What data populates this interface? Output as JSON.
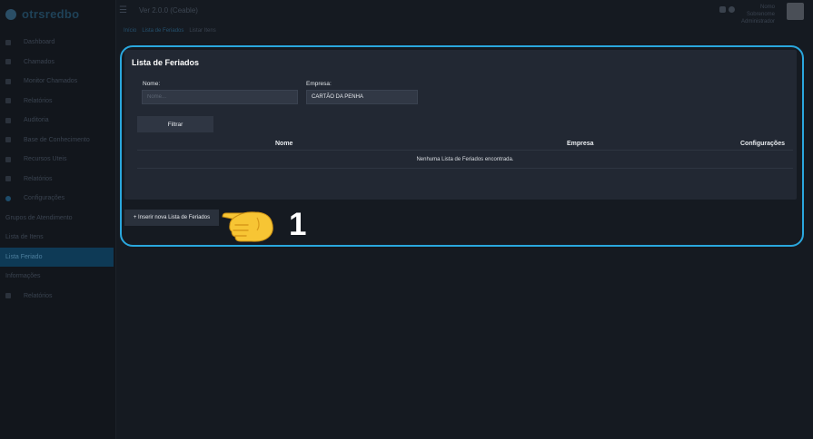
{
  "app": {
    "logo_text": "otrsredbo",
    "title": "Ver 2.0.0 (Ceable)"
  },
  "topbar": {
    "user_line1": "Nomo Sobrenome",
    "user_line2": "Administrador"
  },
  "breadcrumb": [
    "Início",
    "Lista de Feriados",
    "Listar Itens"
  ],
  "sidebar": {
    "items": [
      {
        "label": "Dashboard"
      },
      {
        "label": "Chamados"
      },
      {
        "label": "Monitor Chamados"
      },
      {
        "label": "Relatórios"
      },
      {
        "label": "Auditoria"
      },
      {
        "label": "Base de Conhecimento"
      },
      {
        "label": "Recursos Uteis"
      },
      {
        "label": "Relatórios"
      },
      {
        "label": "Configurações"
      },
      {
        "label": "Grupos de Atendimento"
      },
      {
        "label": "Lista de Itens"
      },
      {
        "label": "Lista Feriado"
      },
      {
        "label": "Informações"
      },
      {
        "label": "Relatórios"
      }
    ]
  },
  "panel": {
    "title": "Lista de Feriados",
    "nome_label": "Nome:",
    "nome_placeholder": "Nome...",
    "nome_value": "",
    "empresa_label": "Empresa:",
    "empresa_value": "CARTÃO DA PENHA",
    "filter_button": "Filtrar"
  },
  "table": {
    "columns": [
      "Nome",
      "Empresa",
      "Configurações"
    ],
    "empty_message": "Nenhuma Lista de Feriados encontrada."
  },
  "actions": {
    "insert_button": "+ Inserir nova Lista de Feriados"
  },
  "annotation": {
    "step": "1",
    "pointer": "pointing-hand-icon"
  },
  "colors": {
    "highlight": "#2aa7dd",
    "background": "#151a21",
    "panel": "#222833"
  }
}
